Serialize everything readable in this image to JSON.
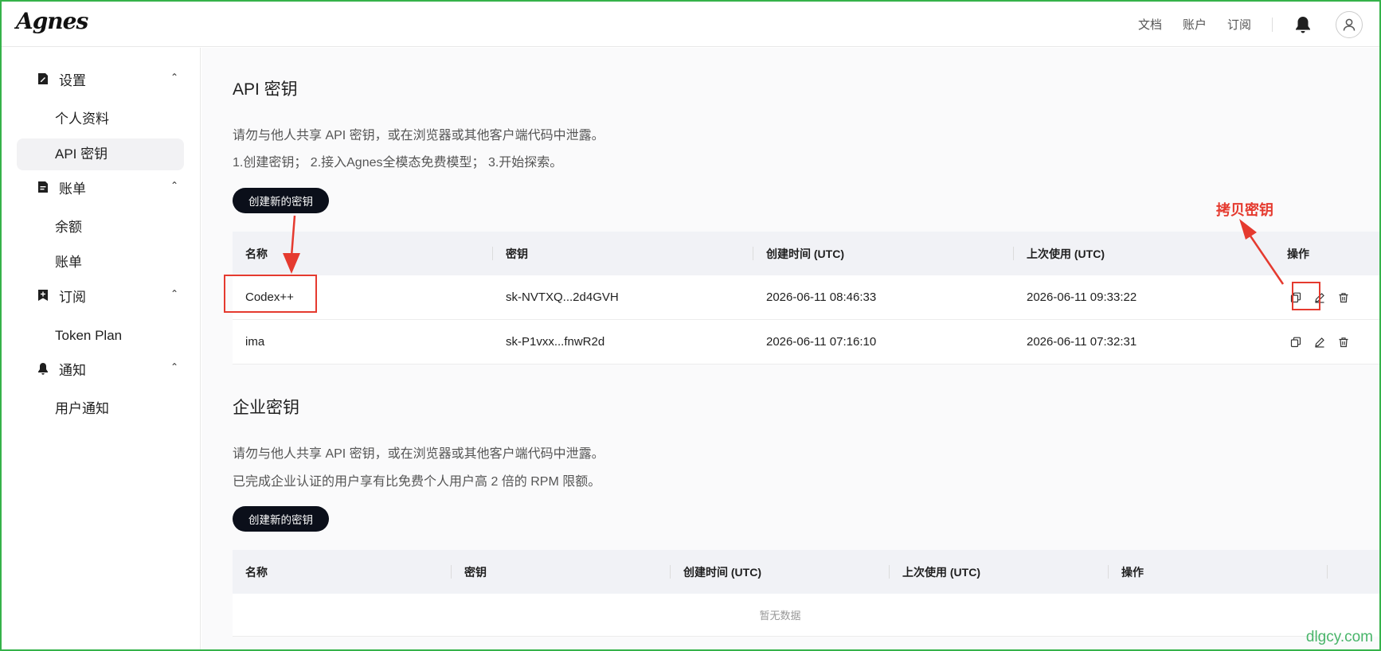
{
  "header": {
    "logo_text": "Agnes",
    "nav": [
      "文档",
      "账户",
      "订阅"
    ]
  },
  "sidebar": {
    "groups": [
      {
        "label": "设置",
        "items": [
          "个人资料",
          "API 密钥"
        ]
      },
      {
        "label": "账单",
        "items": [
          "余额",
          "账单"
        ]
      },
      {
        "label": "订阅",
        "items": [
          "Token Plan"
        ]
      },
      {
        "label": "通知",
        "items": [
          "用户通知"
        ]
      }
    ],
    "active_item": "API 密钥"
  },
  "api_keys": {
    "title": "API 密钥",
    "desc1": "请勿与他人共享 API 密钥，或在浏览器或其他客户端代码中泄露。",
    "desc2": "1.创建密钥； 2.接入Agnes全模态免费模型； 3.开始探索。",
    "create_label": "创建新的密钥",
    "columns": [
      "名称",
      "密钥",
      "创建时间 (UTC)",
      "上次使用 (UTC)",
      "操作"
    ],
    "rows": [
      {
        "name": "Codex++",
        "key": "sk-NVTXQ...2d4GVH",
        "created": "2026-06-11 08:46:33",
        "last_used": "2026-06-11 09:33:22"
      },
      {
        "name": "ima",
        "key": "sk-P1vxx...fnwR2d",
        "created": "2026-06-11 07:16:10",
        "last_used": "2026-06-11 07:32:31"
      }
    ]
  },
  "enterprise_keys": {
    "title": "企业密钥",
    "desc1": "请勿与他人共享 API 密钥，或在浏览器或其他客户端代码中泄露。",
    "desc2": "已完成企业认证的用户享有比免费个人用户高 2 倍的 RPM 限额。",
    "create_label": "创建新的密钥",
    "columns": [
      "名称",
      "密钥",
      "创建时间 (UTC)",
      "上次使用 (UTC)",
      "操作"
    ],
    "empty_text": "暂无数据"
  },
  "annotation": {
    "label": "拷贝密钥",
    "color": "#e53a2f"
  },
  "watermark": "dlgcy.com"
}
